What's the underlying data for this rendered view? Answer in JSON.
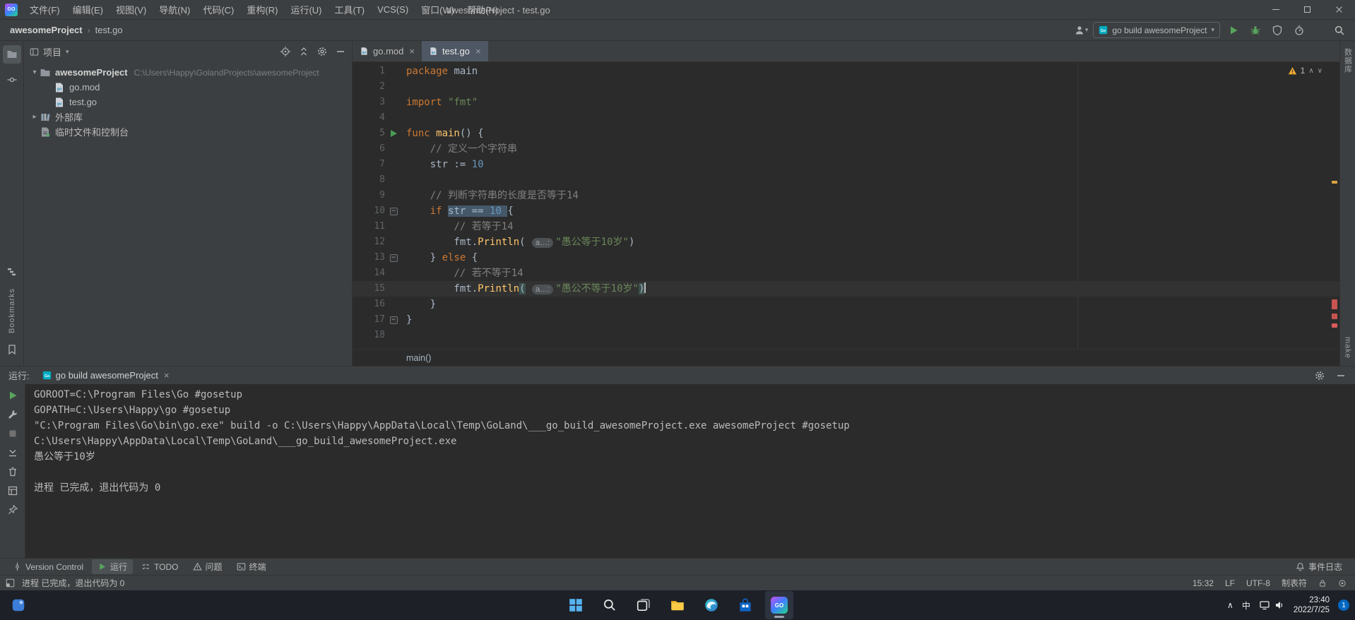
{
  "palette": {
    "panel_bg": "#3C3F41",
    "editor_bg": "#2B2B2B",
    "border": "#323232",
    "text": "#BBBBBB",
    "keyword": "#CC7832",
    "string": "#6A8759",
    "comment": "#808080",
    "number": "#6897BB",
    "function": "#FFC66B",
    "code_text": "#A9B7C6",
    "selection": "#44586A",
    "current_line": "#323232",
    "run_green": "#499C54",
    "warning": "#F0A732",
    "error_mark": "#C75450",
    "taskbar_bg": "#1D2027",
    "badge_blue": "#0067C0"
  },
  "titlebar": {
    "app_icon": "GO",
    "menus": [
      "文件(F)",
      "编辑(E)",
      "视图(V)",
      "导航(N)",
      "代码(C)",
      "重构(R)",
      "运行(U)",
      "工具(T)",
      "VCS(S)",
      "窗口(W)",
      "帮助(H)"
    ],
    "title": "awesomeProject - test.go"
  },
  "navbar": {
    "project_crumb": "awesomeProject",
    "file_crumb": "test.go",
    "run_config": "go build awesomeProject"
  },
  "left_stripe": {
    "bottom_label": "Bookmarks"
  },
  "right_stripe": {
    "top_label": "数据库",
    "bottom_label": "make"
  },
  "project": {
    "header": "项目",
    "tree": [
      {
        "kind": "folder",
        "arrow": "down",
        "label": "awesomeProject",
        "path": "C:\\Users\\Happy\\GolandProjects\\awesomeProject",
        "indent": 0,
        "bold": true
      },
      {
        "kind": "gofile",
        "label": "go.mod",
        "indent": 1
      },
      {
        "kind": "gofile",
        "label": "test.go",
        "indent": 1
      },
      {
        "kind": "lib",
        "arrow": "right",
        "label": "外部库",
        "indent": 0
      },
      {
        "kind": "scratch",
        "label": "临时文件和控制台",
        "indent": 0
      }
    ]
  },
  "editor": {
    "tabs": [
      {
        "label": "go.mod",
        "active": false
      },
      {
        "label": "test.go",
        "active": true
      }
    ],
    "inspection": {
      "warnings": "1"
    },
    "breadcrumb": "main()",
    "lines": [
      {
        "n": "1",
        "tokens": [
          [
            "kw",
            "package"
          ],
          [
            "pl",
            " main"
          ]
        ]
      },
      {
        "n": "2",
        "tokens": []
      },
      {
        "n": "3",
        "tokens": [
          [
            "kw",
            "import"
          ],
          [
            "pl",
            " "
          ],
          [
            "str",
            "\"fmt\""
          ]
        ]
      },
      {
        "n": "4",
        "tokens": []
      },
      {
        "n": "5",
        "run": true,
        "tokens": [
          [
            "kw",
            "func"
          ],
          [
            "fn",
            " main"
          ],
          [
            "pl",
            "() {"
          ]
        ]
      },
      {
        "n": "6",
        "tokens": [
          [
            "pl",
            "    "
          ],
          [
            "com",
            "// 定义一个字符串"
          ]
        ]
      },
      {
        "n": "7",
        "tokens": [
          [
            "pl",
            "    str := "
          ],
          [
            "num",
            "10"
          ]
        ]
      },
      {
        "n": "8",
        "tokens": []
      },
      {
        "n": "9",
        "tokens": [
          [
            "pl",
            "    "
          ],
          [
            "com",
            "// 判断字符串的长度是否等于14"
          ]
        ]
      },
      {
        "n": "10",
        "fold": true,
        "tokens": [
          [
            "pl",
            "    "
          ],
          [
            "kw",
            "if"
          ],
          [
            "pl",
            " "
          ],
          [
            "sel",
            "str == "
          ],
          [
            "num sel",
            "10"
          ],
          [
            "sel",
            " "
          ],
          [
            "pl",
            "{"
          ]
        ]
      },
      {
        "n": "11",
        "tokens": [
          [
            "pl",
            "        "
          ],
          [
            "com",
            "// 若等于14"
          ]
        ]
      },
      {
        "n": "12",
        "tokens": [
          [
            "pl",
            "        fmt."
          ],
          [
            "fn",
            "Println"
          ],
          [
            "pl",
            "( "
          ],
          [
            "hint",
            "a…:"
          ],
          [
            "str",
            "\"愚公等于10岁\""
          ],
          [
            "pl",
            ")"
          ]
        ]
      },
      {
        "n": "13",
        "fold": true,
        "tokens": [
          [
            "pl",
            "    } "
          ],
          [
            "kw",
            "else"
          ],
          [
            "pl",
            " {"
          ]
        ]
      },
      {
        "n": "14",
        "tokens": [
          [
            "pl",
            "        "
          ],
          [
            "com",
            "// 若不等于14"
          ]
        ]
      },
      {
        "n": "15",
        "current": true,
        "tokens": [
          [
            "pl",
            "        fmt."
          ],
          [
            "fn",
            "Println"
          ],
          [
            "brace",
            "("
          ],
          [
            "pl",
            " "
          ],
          [
            "hint",
            "a…:"
          ],
          [
            "str",
            "\"愚公不等于10岁\""
          ],
          [
            "brace",
            ")"
          ],
          [
            "caret",
            ""
          ]
        ]
      },
      {
        "n": "16",
        "tokens": [
          [
            "pl",
            "    }"
          ]
        ]
      },
      {
        "n": "17",
        "fold": true,
        "tokens": [
          [
            "pl",
            "}"
          ]
        ]
      },
      {
        "n": "18",
        "tokens": []
      }
    ]
  },
  "run_panel": {
    "label": "运行:",
    "tab_label": "go build awesomeProject",
    "console": [
      "GOROOT=C:\\Program Files\\Go #gosetup",
      "GOPATH=C:\\Users\\Happy\\go #gosetup",
      "\"C:\\Program Files\\Go\\bin\\go.exe\" build -o C:\\Users\\Happy\\AppData\\Local\\Temp\\GoLand\\___go_build_awesomeProject.exe awesomeProject #gosetup",
      "C:\\Users\\Happy\\AppData\\Local\\Temp\\GoLand\\___go_build_awesomeProject.exe",
      "愚公等于10岁",
      "",
      "进程 已完成，退出代码为 0"
    ]
  },
  "toolwindow_bar": {
    "left": [
      {
        "id": "version-control",
        "label": "Version Control",
        "icon": "vcs",
        "active": false
      },
      {
        "id": "run",
        "label": "运行",
        "icon": "runsmall",
        "active": true
      },
      {
        "id": "todo",
        "label": "TODO",
        "icon": "todo",
        "active": false
      },
      {
        "id": "problems",
        "label": "问题",
        "icon": "problems",
        "active": false
      },
      {
        "id": "terminal",
        "label": "终端",
        "icon": "terminal",
        "active": false
      }
    ],
    "right": [
      {
        "id": "event-log",
        "label": "事件日志",
        "icon": "eventlog",
        "active": false
      }
    ]
  },
  "statusbar": {
    "message": "进程 已完成，退出代码为 0",
    "caret": "15:32",
    "line_ending": "LF",
    "encoding": "UTF-8",
    "indent": "制表符"
  },
  "taskbar": {
    "ime": "中",
    "time": "23:40",
    "date": "2022/7/25",
    "badge": "1"
  }
}
